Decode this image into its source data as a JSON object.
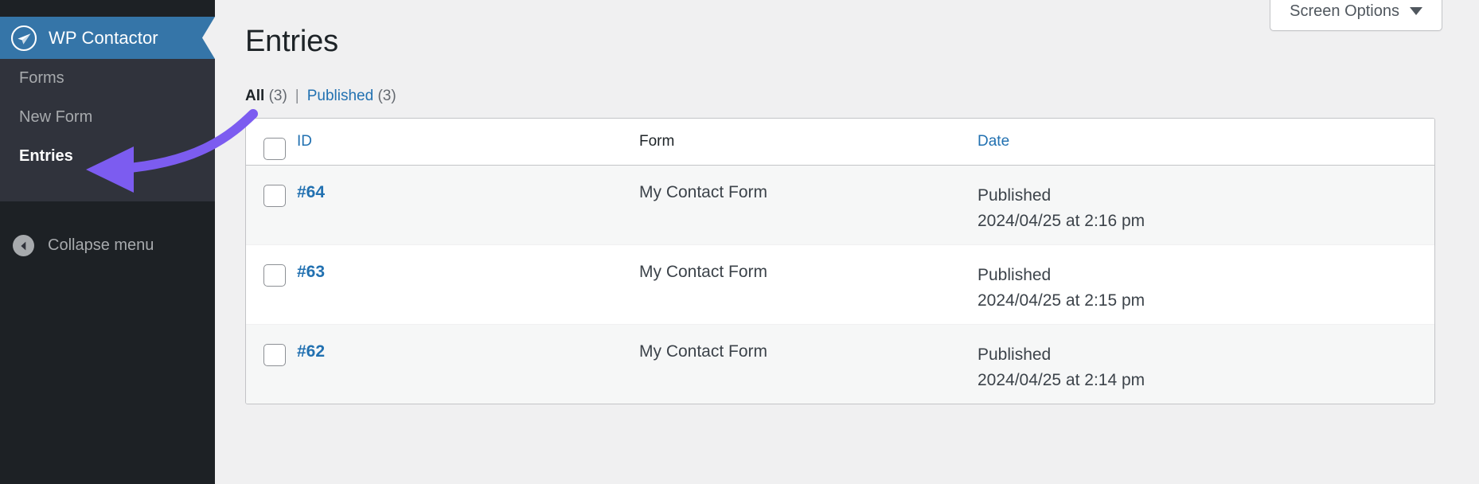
{
  "sidebar": {
    "brand": {
      "title": "WP Contactor",
      "icon": "paper-plane-icon",
      "bg_color": "#3575a8"
    },
    "items": [
      {
        "label": "Forms",
        "active": false
      },
      {
        "label": "New Form",
        "active": false
      },
      {
        "label": "Entries",
        "active": true
      }
    ],
    "collapse": {
      "label": "Collapse menu",
      "icon": "chevron-left-circle-icon"
    },
    "bg_color": "#30333c",
    "footer_bg_color": "#1d2125"
  },
  "header": {
    "screen_options": {
      "label": "Screen Options",
      "icon": "chevron-down-icon"
    }
  },
  "main": {
    "page_title": "Entries",
    "filters": [
      {
        "label": "All",
        "count": "(3)",
        "current": true
      },
      {
        "label": "Published",
        "count": "(3)",
        "current": false
      }
    ],
    "filter_separator": "|"
  },
  "table": {
    "columns": [
      {
        "key": "cb",
        "label": "",
        "sortable": false
      },
      {
        "key": "id",
        "label": "ID",
        "sortable": true
      },
      {
        "key": "form",
        "label": "Form",
        "sortable": false
      },
      {
        "key": "date",
        "label": "Date",
        "sortable": true
      }
    ],
    "rows": [
      {
        "id": "#64",
        "form": "My Contact Form",
        "status": "Published",
        "timestamp": "2024/04/25 at 2:16 pm"
      },
      {
        "id": "#63",
        "form": "My Contact Form",
        "status": "Published",
        "timestamp": "2024/04/25 at 2:15 pm"
      },
      {
        "id": "#62",
        "form": "My Contact Form",
        "status": "Published",
        "timestamp": "2024/04/25 at 2:14 pm"
      }
    ]
  },
  "annotation": {
    "type": "curved-arrow",
    "points_to": "Entries",
    "color": "#7c5cf0"
  },
  "colors": {
    "brand_blue": "#3575a8",
    "link_blue": "#2271b1",
    "sidebar_dark": "#30333c",
    "sidebar_darker": "#1d2125",
    "page_bg": "#f0f0f1",
    "row_alt": "#f6f7f7",
    "annotation_purple": "#7c5cf0"
  }
}
